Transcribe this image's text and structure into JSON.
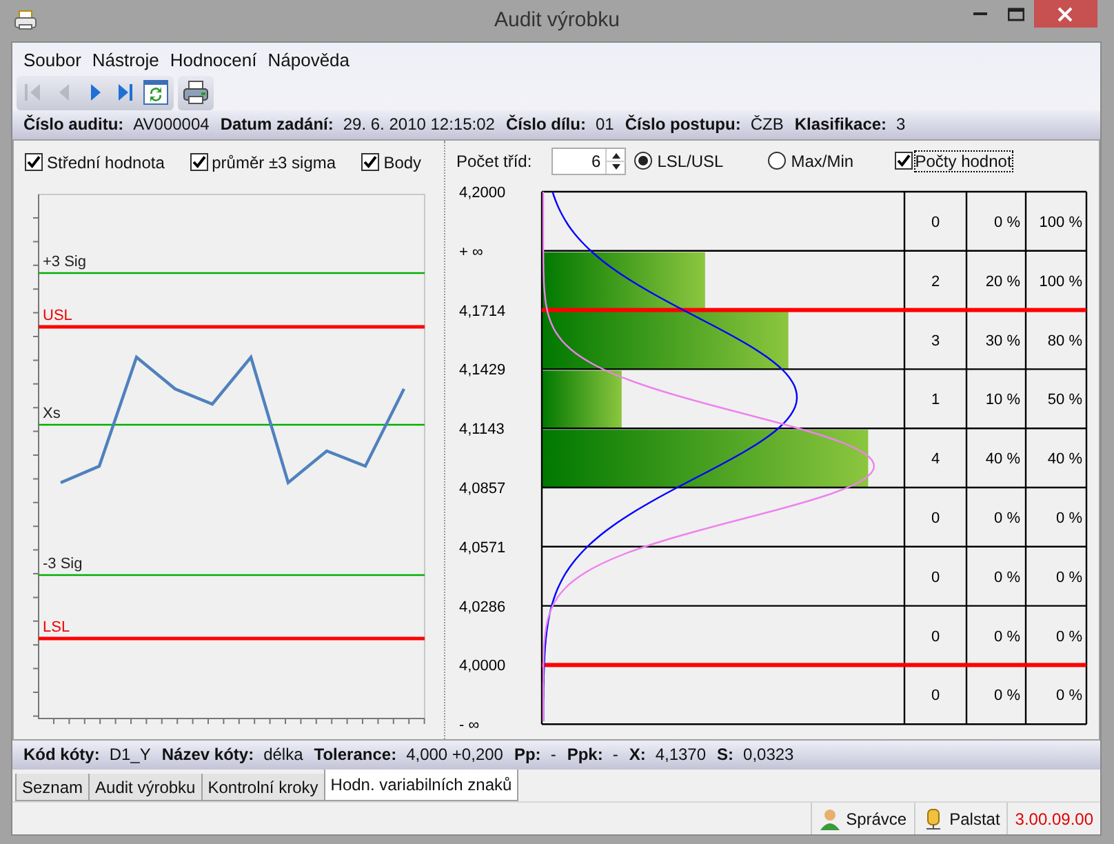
{
  "window": {
    "title": "Audit výrobku",
    "controls": [
      {
        "kind": "minimize"
      },
      {
        "kind": "maximize"
      },
      {
        "kind": "close"
      }
    ]
  },
  "menu": [
    "Soubor",
    "Nástroje",
    "Hodnocení",
    "Nápověda"
  ],
  "toolbar_groups": [
    [
      {
        "kind": "first",
        "disabled": true
      },
      {
        "kind": "previous",
        "disabled": true
      },
      {
        "kind": "next",
        "disabled": false
      },
      {
        "kind": "last",
        "disabled": false
      },
      {
        "kind": "refresh",
        "disabled": false
      }
    ],
    [
      {
        "kind": "print",
        "disabled": false
      }
    ]
  ],
  "audit_info": [
    {
      "label": "Číslo auditu:",
      "value": "AV000004"
    },
    {
      "label": "Datum zadání:",
      "value": "29. 6. 2010 12:15:02"
    },
    {
      "label": "Číslo dílu:",
      "value": "01"
    },
    {
      "label": "Číslo postupu:",
      "value": "ČZB"
    },
    {
      "label": "Klasifikace:",
      "value": "3"
    }
  ],
  "left_panel": {
    "options": [
      {
        "label": "Střední hodnota",
        "checked": true
      },
      {
        "label": "průměr  ±3 sigma",
        "checked": true
      },
      {
        "label": "Body",
        "checked": true
      }
    ],
    "chart": {
      "lines": [
        {
          "label": "+3 Sig",
          "kind": "sigma"
        },
        {
          "label": "USL",
          "kind": "limit"
        },
        {
          "label": "Xs",
          "kind": "mean"
        },
        {
          "label": "-3 Sig",
          "kind": "sigma"
        },
        {
          "label": "LSL",
          "kind": "limit"
        }
      ]
    }
  },
  "right_panel": {
    "class_count": {
      "label": "Počet tříd:",
      "value": "6"
    },
    "range_modes": [
      {
        "label": "LSL/USL",
        "selected": true
      },
      {
        "label": "Max/Min",
        "selected": false
      }
    ],
    "show_counts": {
      "label": "Počty hodnot",
      "checked": true
    },
    "histogram": {
      "boundaries": [
        {
          "label": "4,2000",
          "limit": false
        },
        {
          "label": "+ ∞",
          "limit": false
        },
        {
          "label": "4,1714",
          "limit": true
        },
        {
          "label": "4,1429",
          "limit": false
        },
        {
          "label": "4,1143",
          "limit": false
        },
        {
          "label": "4,0857",
          "limit": false
        },
        {
          "label": "4,0571",
          "limit": false
        },
        {
          "label": "4,0286",
          "limit": false
        },
        {
          "label": "4,0000",
          "limit": true
        },
        {
          "label": "- ∞",
          "limit": false
        }
      ],
      "rows": [
        {
          "count": "0",
          "percent": "0 %",
          "cumulative": "100 %"
        },
        {
          "count": "2",
          "percent": "20 %",
          "cumulative": "100 %",
          "level": 0.45
        },
        {
          "count": "3",
          "percent": "30 %",
          "cumulative": "80 %",
          "level": 0.68
        },
        {
          "count": "1",
          "percent": "10 %",
          "cumulative": "50 %",
          "level": 0.22
        },
        {
          "count": "4",
          "percent": "40 %",
          "cumulative": "40 %",
          "level": 0.9
        },
        {
          "count": "0",
          "percent": "0 %",
          "cumulative": "0 %"
        },
        {
          "count": "0",
          "percent": "0 %",
          "cumulative": "0 %"
        },
        {
          "count": "0",
          "percent": "0 %",
          "cumulative": "0 %"
        },
        {
          "count": "0",
          "percent": "0 %",
          "cumulative": "0 %"
        }
      ]
    }
  },
  "characteristic": [
    {
      "label": "Kód kóty:",
      "value": "D1_Y"
    },
    {
      "label": "Název kóty:",
      "value": "délka"
    },
    {
      "label": "Tolerance:",
      "value": "4,000 +0,200"
    },
    {
      "label": "Pp:",
      "value": "-"
    },
    {
      "label": "Ppk:",
      "value": "-"
    },
    {
      "label": "X:",
      "value": "4,1370"
    },
    {
      "label": "S:",
      "value": "0,0323"
    }
  ],
  "tabs": [
    {
      "label": "Seznam",
      "selected": false
    },
    {
      "label": "Audit výrobku",
      "selected": false
    },
    {
      "label": "Kontrolní kroky",
      "selected": false
    },
    {
      "label": "Hodn. variabilních znaků",
      "selected": true
    }
  ],
  "status_bar": [
    {
      "kind": "user",
      "text": "Správce"
    },
    {
      "kind": "database",
      "text": "Palstat"
    },
    {
      "kind": "version",
      "text": "3.00.09.00"
    }
  ]
}
